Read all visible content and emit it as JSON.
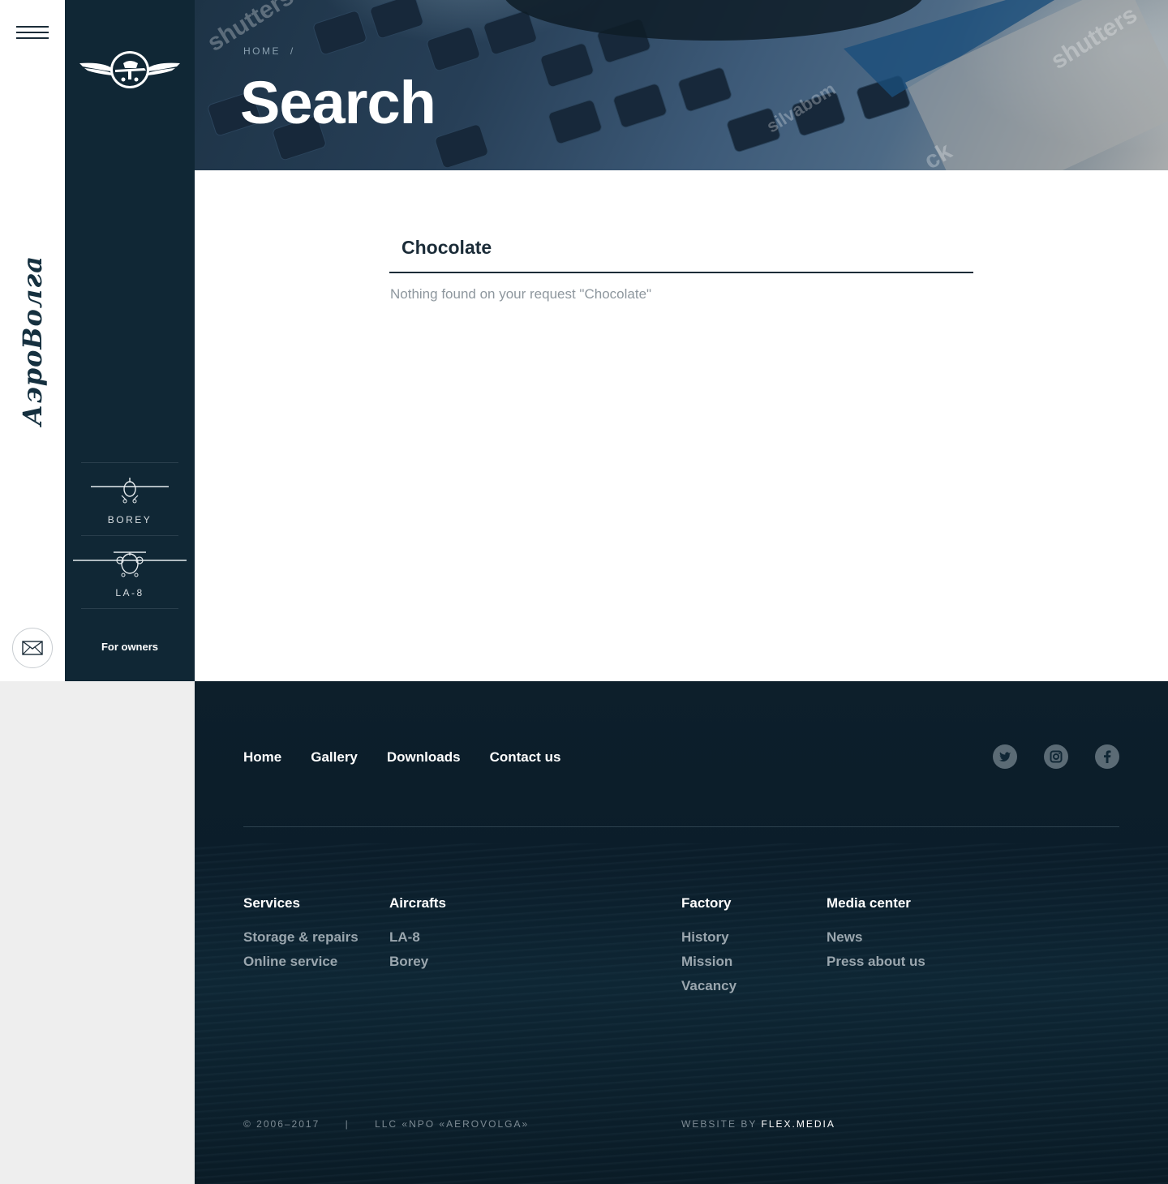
{
  "brand": {
    "name": "АэроВолга",
    "logo_icon": "winged-aircraft-emblem"
  },
  "rail": {
    "menu_icon": "hamburger-icon",
    "mail_icon": "envelope-icon"
  },
  "sidebar": {
    "aircraft": [
      {
        "label": "BOREY",
        "icon": "borey-plane-icon"
      },
      {
        "label": "LA-8",
        "icon": "la8-plane-icon"
      }
    ],
    "owners_label": "For owners"
  },
  "hero": {
    "breadcrumb_home": "HOME",
    "breadcrumb_sep": "/",
    "title": "Search"
  },
  "search": {
    "query": "Chocolate",
    "result_message": "Nothing found on your request \"Chocolate\""
  },
  "footer": {
    "nav": [
      "Home",
      "Gallery",
      "Downloads",
      "Contact us"
    ],
    "social": [
      {
        "name": "twitter-icon",
        "glyph": "t"
      },
      {
        "name": "instagram-icon",
        "glyph": "◎"
      },
      {
        "name": "facebook-icon",
        "glyph": "f"
      }
    ],
    "columns": [
      {
        "heading": "Services",
        "links": [
          "Storage & repairs",
          "Online service"
        ]
      },
      {
        "heading": "Aircrafts",
        "links": [
          "LA-8",
          "Borey"
        ]
      },
      {
        "heading": "Factory",
        "links": [
          "History",
          "Mission",
          "Vacancy"
        ]
      },
      {
        "heading": "Media center",
        "links": [
          "News",
          "Press about us"
        ]
      }
    ],
    "copyright": "© 2006–2017",
    "company": "LLC «NPO «AEROVOLGA»",
    "credit_prefix": "WEBSITE BY",
    "credit_link": "FLEX.MEDIA"
  },
  "colors": {
    "sidebar_bg": "#102735",
    "footer_bg": "#0b1d2a",
    "accent_text": "#1b2c38"
  }
}
